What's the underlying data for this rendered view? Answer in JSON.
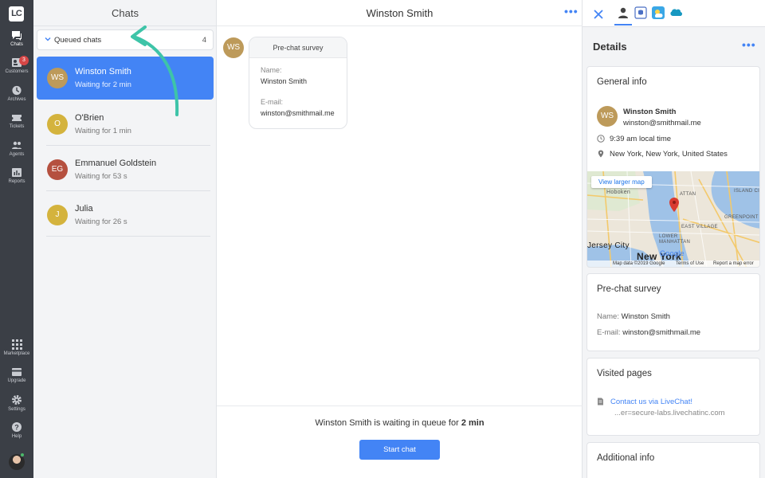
{
  "nav": {
    "logo": "LC",
    "items": [
      {
        "label": "Chats",
        "icon": "chats-icon",
        "active": true
      },
      {
        "label": "Customers",
        "icon": "customers-icon",
        "badge": "3"
      },
      {
        "label": "Archives",
        "icon": "clock-icon"
      },
      {
        "label": "Tickets",
        "icon": "ticket-icon"
      },
      {
        "label": "Agents",
        "icon": "agents-icon"
      },
      {
        "label": "Reports",
        "icon": "reports-icon"
      },
      {
        "label": "Marketplace",
        "icon": "grid-icon"
      },
      {
        "label": "Upgrade",
        "icon": "card-icon"
      },
      {
        "label": "Settings",
        "icon": "gear-icon"
      },
      {
        "label": "Help",
        "icon": "help-icon"
      }
    ]
  },
  "chats": {
    "title": "Chats",
    "queued": {
      "label": "Queued chats",
      "count": "4"
    },
    "items": [
      {
        "initials": "WS",
        "name": "Winston Smith",
        "status": "Waiting for 2 min",
        "color": "#bd9a5a"
      },
      {
        "initials": "O",
        "name": "O'Brien",
        "status": "Waiting for 1 min",
        "color": "#d4b33d"
      },
      {
        "initials": "EG",
        "name": "Emmanuel Goldstein",
        "status": "Waiting for 53 s",
        "color": "#b5503f"
      },
      {
        "initials": "J",
        "name": "Julia",
        "status": "Waiting for 26 s",
        "color": "#d4b33d"
      }
    ]
  },
  "conversation": {
    "title": "Winston Smith",
    "avatar": "WS",
    "survey": {
      "title": "Pre-chat survey",
      "name_label": "Name:",
      "name_value": "Winston Smith",
      "email_label": "E-mail:",
      "email_value": "winston@smithmail.me"
    },
    "queue_prefix": "Winston Smith is waiting in queue for",
    "queue_time": "2 min",
    "start_button": "Start chat"
  },
  "details": {
    "title": "Details",
    "general": {
      "title": "General info",
      "initials": "WS",
      "name": "Winston Smith",
      "email": "winston@smithmail.me",
      "local_time": "9:39 am local time",
      "location": "New York, New York, United States",
      "map_button": "View larger map",
      "map_labels": [
        "Hoboken",
        "Jersey City",
        "New York",
        "EAST VILLAGE",
        "LOWER MANHATTAN",
        "GREENPOINT",
        "ISLAND CI",
        "ATTAN",
        "Google"
      ],
      "map_footer": [
        "Map data ©2019 Google",
        "Terms of Use",
        "Report a map error"
      ]
    },
    "prechat": {
      "title": "Pre-chat survey",
      "name_label": "Name:",
      "name_value": "Winston Smith",
      "email_label": "E-mail:",
      "email_value": "winston@smithmail.me"
    },
    "visited": {
      "title": "Visited pages",
      "link": "Contact us via LiveChat!",
      "url": "...er=secure-labs.livechatinc.com"
    },
    "additional": {
      "title": "Additional info"
    }
  },
  "colors": {
    "accent": "#4384f5",
    "rail": "#3b3f46",
    "arrow": "#3ec4a8"
  }
}
